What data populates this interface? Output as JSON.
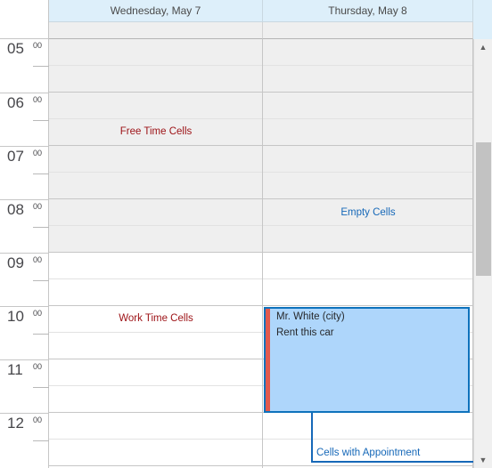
{
  "scheduler": {
    "day_headers": [
      {
        "label": "Wednesday, May 7"
      },
      {
        "label": "Thursday, May 8"
      }
    ],
    "time_ruler": [
      {
        "hour": "05",
        "minute": "00"
      },
      {
        "hour": "06",
        "minute": "00"
      },
      {
        "hour": "07",
        "minute": "00"
      },
      {
        "hour": "08",
        "minute": "00"
      },
      {
        "hour": "09",
        "minute": "00"
      },
      {
        "hour": "10",
        "minute": "00"
      },
      {
        "hour": "11",
        "minute": "00"
      },
      {
        "hour": "12",
        "minute": "00"
      }
    ],
    "annotations": [
      {
        "text": "Free Time Cells",
        "color": "#9c1014"
      },
      {
        "text": "Empty Cells",
        "color": "#1668b8"
      },
      {
        "text": "Work Time Cells",
        "color": "#9c1014"
      },
      {
        "text": "Cells with Appointment",
        "color": "#1668b8"
      }
    ],
    "appointment": {
      "subject": "Mr. White (city)",
      "description": "Rent this car",
      "border_color": "#0e72bc",
      "fill_color": "#aed6fb",
      "status_stripe_color": "#e2594e"
    },
    "scrollbar": {
      "up_arrow": "▲",
      "down_arrow": "▼"
    }
  }
}
